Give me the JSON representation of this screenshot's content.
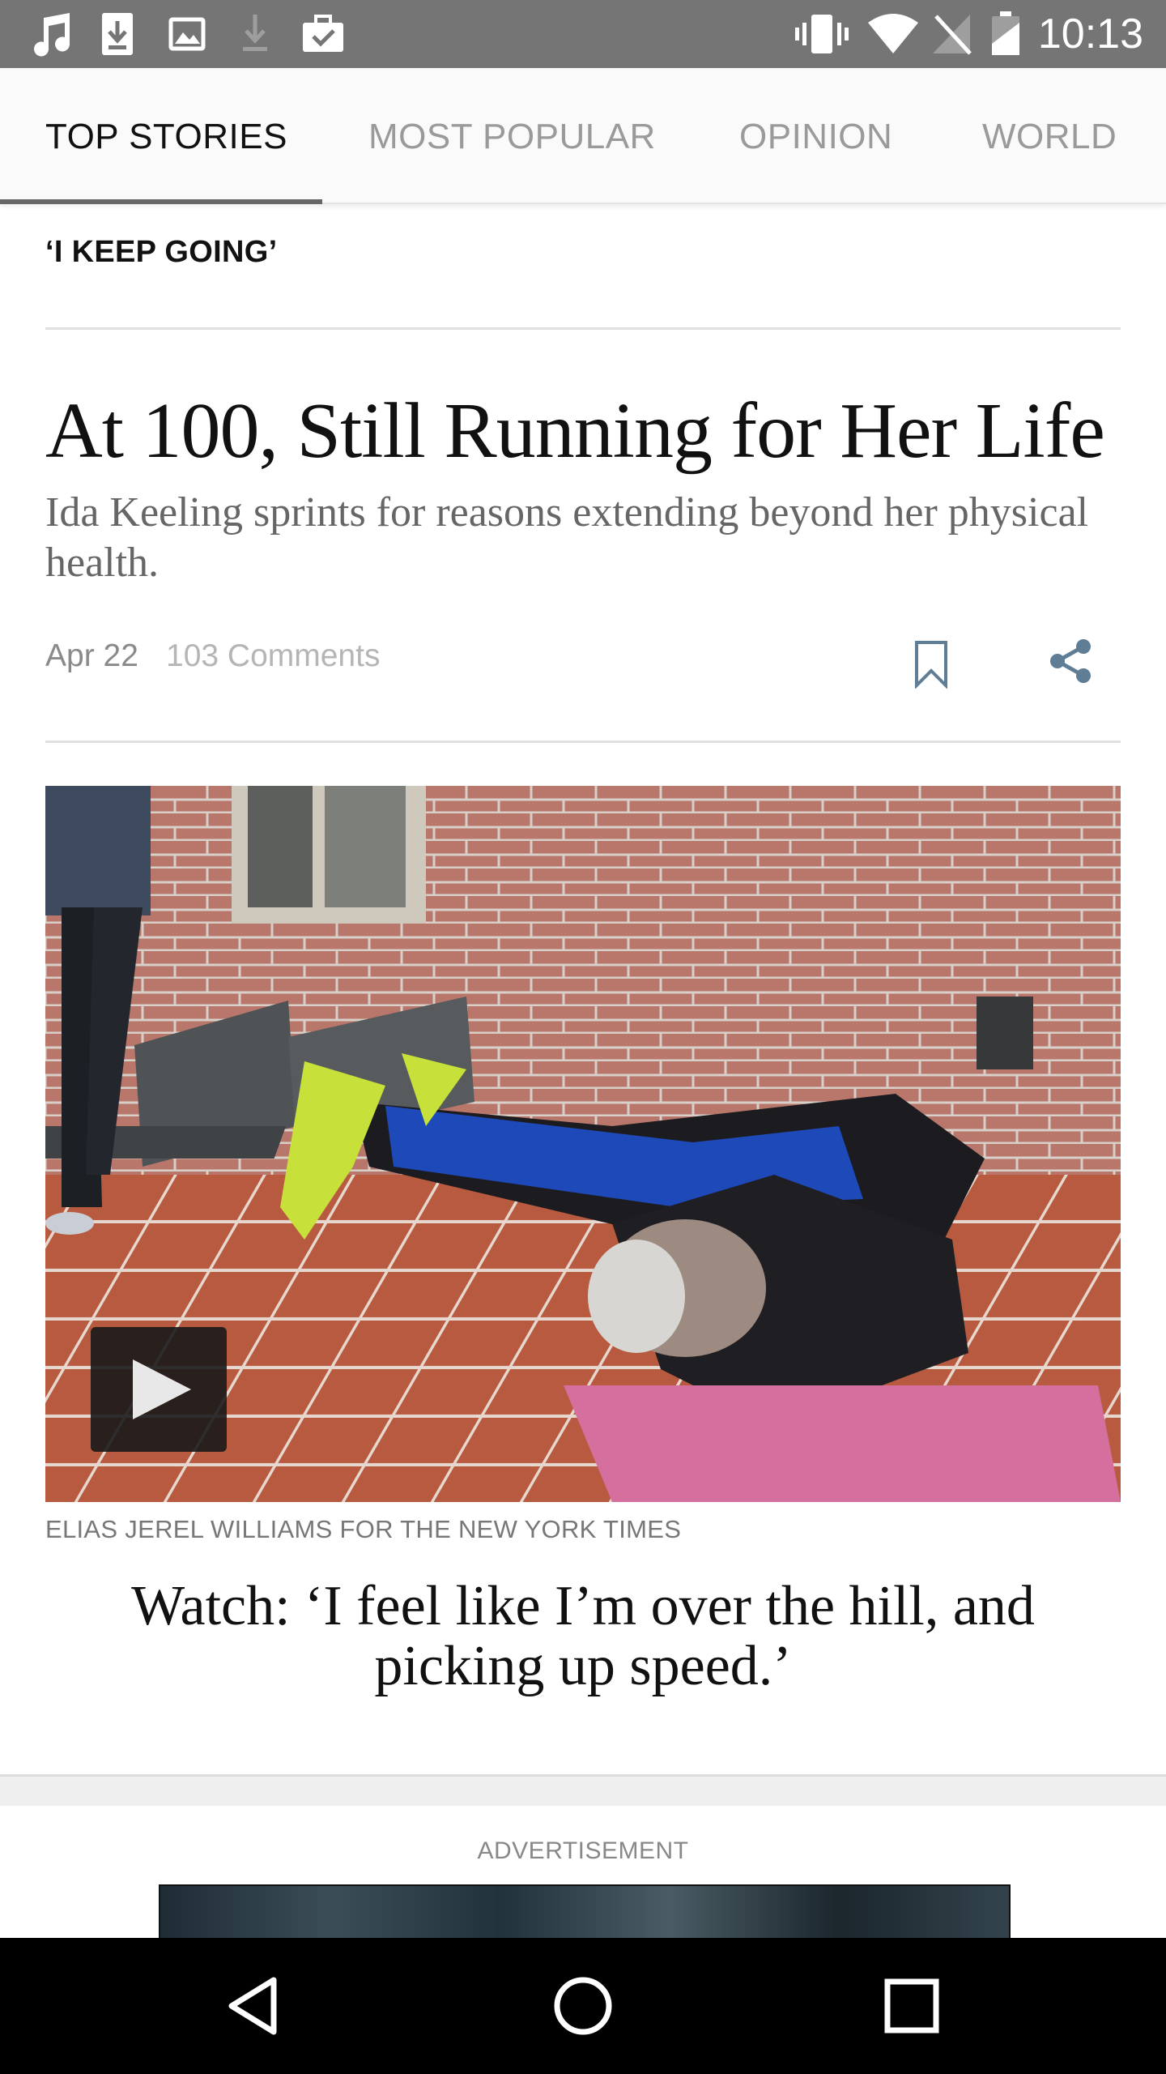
{
  "status_bar": {
    "time": "10:13",
    "left_icons": [
      "music-note-icon",
      "download-icon",
      "image-icon",
      "download-icon",
      "briefcase-check-icon"
    ],
    "right_icons": [
      "vibrate-icon",
      "wifi-icon",
      "no-signal-icon",
      "battery-icon"
    ]
  },
  "tabs": [
    {
      "label": "TOP STORIES",
      "active": true
    },
    {
      "label": "MOST POPULAR",
      "active": false
    },
    {
      "label": "OPINION",
      "active": false
    },
    {
      "label": "WORLD",
      "active": false
    }
  ],
  "article": {
    "kicker": "‘I KEEP GOING’",
    "headline": "At 100, Still Running for Her Life",
    "summary": "Ida Keeling sprints for reasons extending beyond her physical health.",
    "date": "Apr 22",
    "comments": "103 Comments",
    "image_credit": "ELIAS JEREL WILLIAMS FOR THE NEW YORK TIMES",
    "video_caption": "Watch: ‘I feel like I’m over the hill, and picking up speed.’"
  },
  "ad": {
    "label": "ADVERTISEMENT"
  },
  "colors": {
    "status_bar": "#757575",
    "tab_active": "#111111",
    "tab_inactive": "#9a9a9a",
    "icon_accent": "#5f7d95"
  },
  "nav_bar": {
    "buttons": [
      "back-icon",
      "home-icon",
      "recents-icon"
    ]
  }
}
